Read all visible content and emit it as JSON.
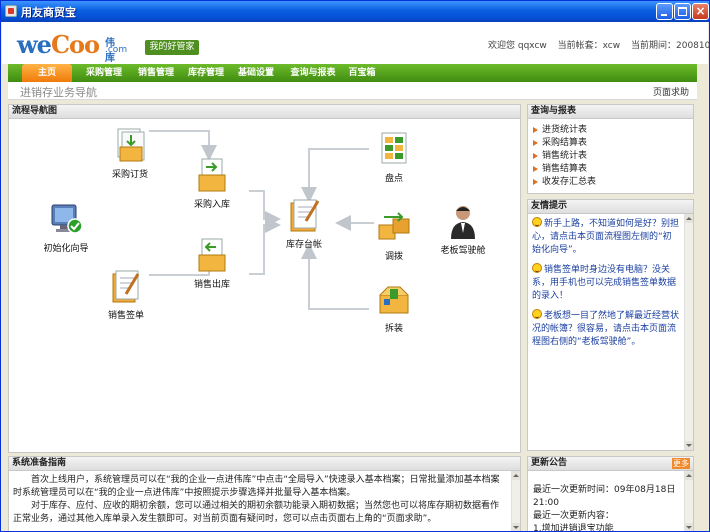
{
  "window": {
    "title": "用友商贸宝"
  },
  "header": {
    "logo_we": "we",
    "logo_coo": "Coo",
    "logo_cn": "伟库网",
    "logo_domain": ".com",
    "logo_badge": "我的好管家",
    "welcome": "欢迎您 qqxcw",
    "account": "当前帐套：xcw",
    "date": "当前期间：200810"
  },
  "nav": {
    "items": [
      {
        "label": "主页",
        "active": true
      },
      {
        "label": "采购管理"
      },
      {
        "label": "销售管理"
      },
      {
        "label": "库存管理"
      },
      {
        "label": "基础设置"
      },
      {
        "label": "查询与报表"
      },
      {
        "label": "百宝箱"
      }
    ]
  },
  "subbar": {
    "breadcrumb": "进销存业务导航",
    "help": "页面求助"
  },
  "flow": {
    "title": "流程导航图",
    "nodes": {
      "purchase_order": "采购订货",
      "purchase_in": "采购入库",
      "init_wizard": "初始化向导",
      "sales_out": "销售出库",
      "sales_sign": "销售签单",
      "stock_ledger": "库存台帐",
      "stocktake": "盘点",
      "transfer": "调拨",
      "boss_cockpit": "老板驾驶舱",
      "disassembly": "拆装"
    }
  },
  "report": {
    "title": "查询与报表",
    "items": [
      "进货统计表",
      "采购结算表",
      "销售统计表",
      "销售结算表",
      "收发存汇总表"
    ]
  },
  "tips": {
    "title": "友情提示",
    "items": [
      "新手上路，不知道如何是好？别担心，请点击本页面流程图左侧的“初始化向导”。",
      "销售签单时身边没有电脑？没关系，用手机也可以完成销售签单数据的录入！",
      "老板想一目了然地了解最近经营状况的帐簿？很容易，请点击本页面流程图右侧的“老板驾驶舱”。"
    ]
  },
  "guide": {
    "title": "系统准备指南",
    "paragraphs": [
      "首次上线用户，系统管理员可以在“我的企业一点进伟库”中点击“全局导入”快速录入基本档案；日常批量添加基本档案时系统管理员可以在“我的企业一点进伟库”中按照提示步骤选择并批量导入基本档案。",
      "对于库存、应付、应收的期初余额，您可以通过相关的期初余额功能录入期初数据；当然您也可以将库存期初数据看作正常业务，通过其他入库单录入发生额即可。对当前页面有疑问时，您可以点击页面右上角的“页面求助”。"
    ]
  },
  "news": {
    "title": "更新公告",
    "more": "更多",
    "line1": "最近一次更新时间：09年08月18日",
    "line2": "21:00",
    "line3": "最近一次更新内容：",
    "line4": "1.增加进销退宝功能"
  },
  "colors": {
    "nav_green": "#4f9a1a",
    "home_orange": "#f08a1a",
    "titlebar_blue": "#0a5fe0",
    "tip_blue": "#1a3fa0"
  }
}
